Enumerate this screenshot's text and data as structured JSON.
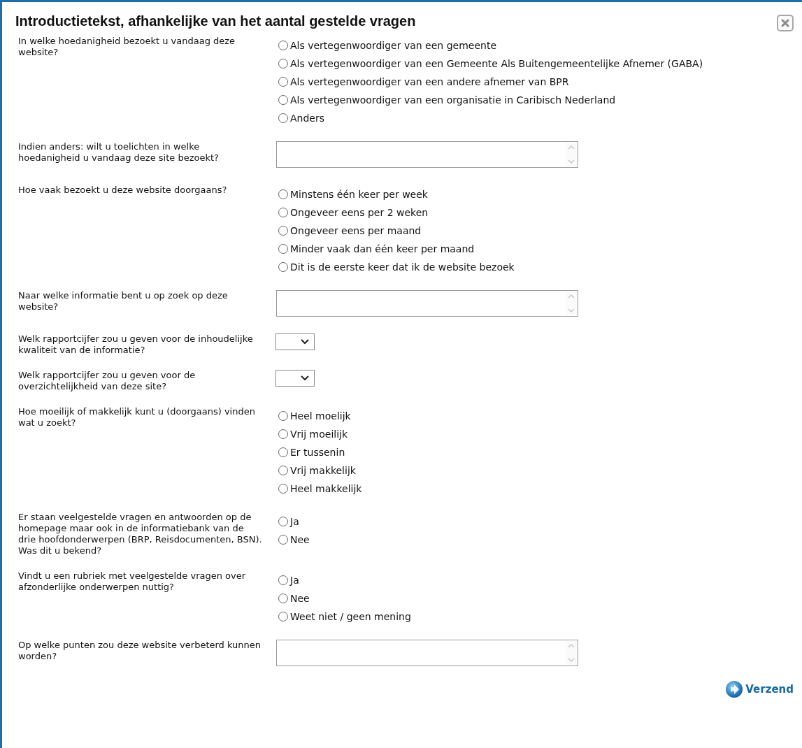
{
  "dialog": {
    "title": "Introductietekst, afhankelijke van het aantal gestelde vragen"
  },
  "questions": [
    {
      "kind": "radio",
      "label": "In welke hoedanigheid bezoekt u vandaag deze website?",
      "options": [
        {
          "label": "Als vertegenwoordiger van een gemeente",
          "selected": false
        },
        {
          "label": "Als vertegenwoordiger van een Gemeente Als Buitengemeentelijke Afnemer (GABA)",
          "selected": false
        },
        {
          "label": "Als vertegenwoordiger van een andere afnemer van BPR",
          "selected": false
        },
        {
          "label": "Als vertegenwoordiger van een organisatie in Caribisch Nederland",
          "selected": false
        },
        {
          "label": "Anders",
          "selected": false
        }
      ]
    },
    {
      "kind": "textarea",
      "label": "Indien anders: wilt u toelichten in welke hoedanigheid u vandaag deze site bezoekt?"
    },
    {
      "kind": "radio",
      "label": "Hoe vaak bezoekt u deze website doorgaans?",
      "options": [
        {
          "label": "Minstens één keer per week",
          "selected": false
        },
        {
          "label": "Ongeveer eens per 2 weken",
          "selected": false
        },
        {
          "label": "Ongeveer eens per maand",
          "selected": false
        },
        {
          "label": "Minder vaak dan één keer per maand",
          "selected": false
        },
        {
          "label": "Dit is de eerste keer dat ik de website bezoek",
          "selected": false
        }
      ]
    },
    {
      "kind": "textarea",
      "label": "Naar welke informatie bent u op zoek op deze website?"
    },
    {
      "kind": "select",
      "label": "Welk rapportcijfer zou u geven voor de inhoudelijke kwaliteit van de informatie?"
    },
    {
      "kind": "select",
      "label": "Welk rapportcijfer zou u geven voor de overzichtelijkheid van deze site?"
    },
    {
      "kind": "radio",
      "label": "Hoe moeilijk of makkelijk kunt u (doorgaans) vinden wat u zoekt?",
      "options": [
        {
          "label": "Heel moelijk",
          "selected": false
        },
        {
          "label": "Vrij moeilijk",
          "selected": false
        },
        {
          "label": "Er tussenin",
          "selected": false
        },
        {
          "label": "Vrij makkelijk",
          "selected": false
        },
        {
          "label": "Heel makkelijk",
          "selected": false
        }
      ]
    },
    {
      "kind": "radio",
      "label": "Er staan veelgestelde vragen en antwoorden op de homepage maar ook in de informatiebank van de drie hoofdonderwerpen (BRP, Reisdocumenten, BSN). Was dit u bekend?",
      "options": [
        {
          "label": "Ja",
          "selected": false
        },
        {
          "label": "Nee",
          "selected": false
        }
      ]
    },
    {
      "kind": "radio",
      "label": "Vindt u een rubriek met veelgestelde vragen over afzonderlijke onderwerpen nuttig?",
      "options": [
        {
          "label": "Ja",
          "selected": false
        },
        {
          "label": "Nee",
          "selected": false
        },
        {
          "label": "Weet niet / geen mening",
          "selected": false
        }
      ]
    },
    {
      "kind": "textarea",
      "label": "Op welke punten zou deze website verbeterd kunnen worden?"
    }
  ],
  "submit": {
    "label": "Verzend"
  }
}
